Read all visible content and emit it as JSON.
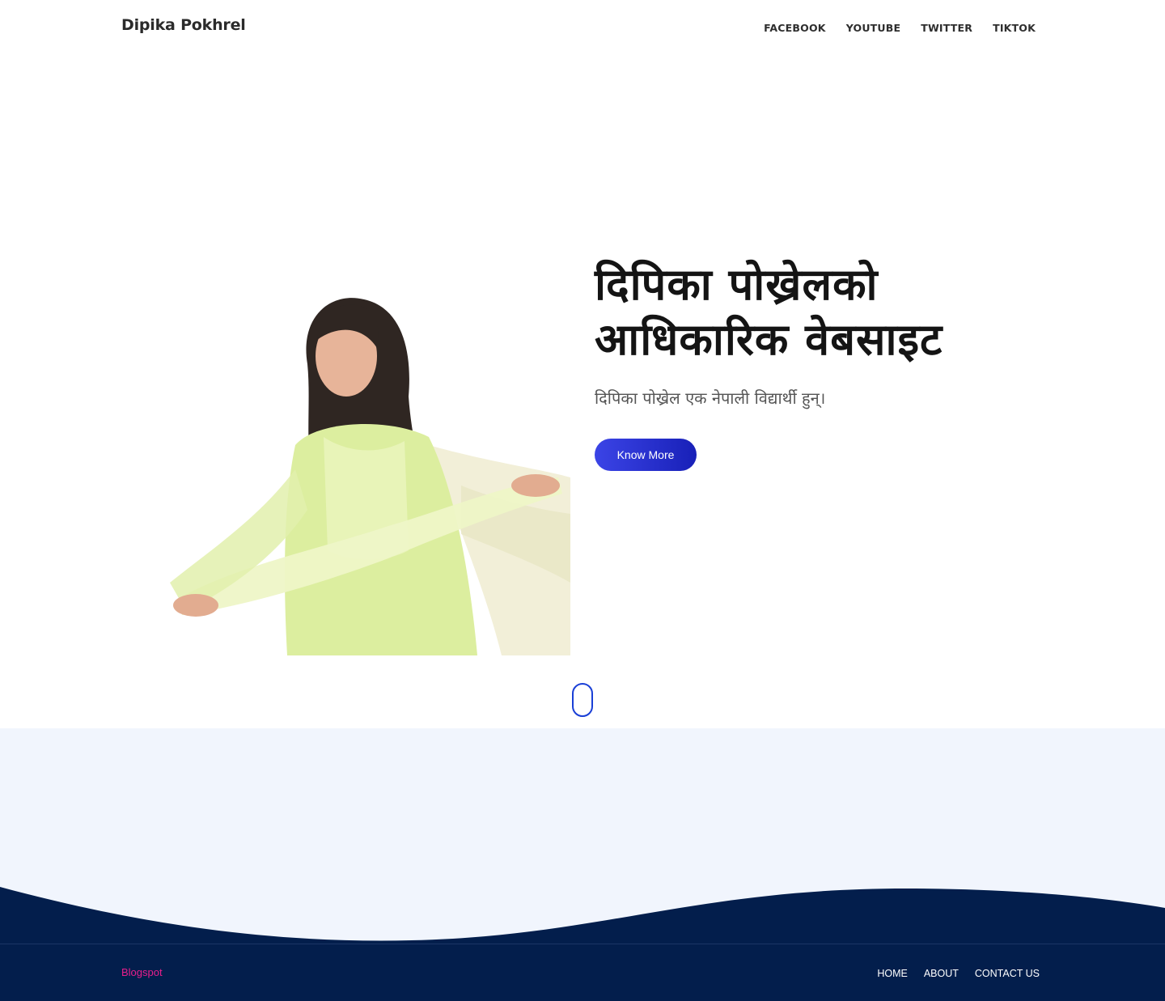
{
  "header": {
    "brand": "Dipika Pokhrel",
    "nav": [
      "FACEBOOK",
      "YOUTUBE",
      "TWITTER",
      "TIKTOK"
    ]
  },
  "hero": {
    "title_line1": "दिपिका पोख्रेलको",
    "title_line2": "आधिकारिक वेबसाइट",
    "subtitle": "दिपिका पोख्रेल एक नेपाली विद्यार्थी हुन्।",
    "button_label": "Know More",
    "image_alt": "Dipika Pokhrel"
  },
  "footer": {
    "brand": "Blogspot",
    "nav": [
      "HOME",
      "ABOUT",
      "CONTACT US"
    ]
  },
  "colors": {
    "accent": "#2a35d8",
    "footer_bg": "#031e4c",
    "light_section": "#f1f5fd",
    "footer_brand": "#e91e8c"
  }
}
